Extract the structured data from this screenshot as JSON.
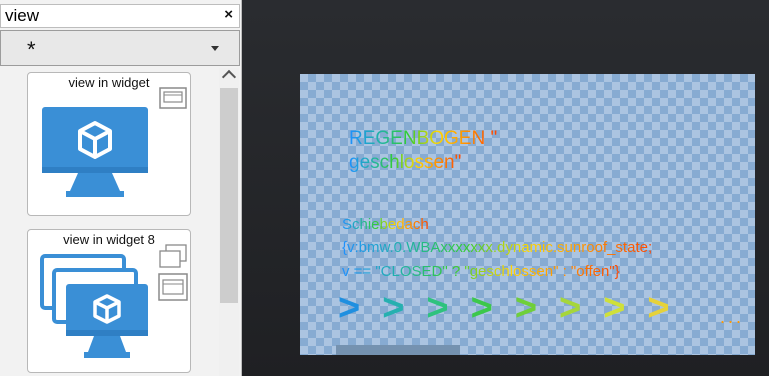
{
  "search": {
    "value": "view",
    "clear_glyph": "×"
  },
  "filter": {
    "value": "*"
  },
  "widgets": [
    {
      "label": "view in widget",
      "icon": "monitor-cube-icon",
      "badge_icon": "window-icon"
    },
    {
      "label": "view in widget 8",
      "icon": "stacked-monitors-cube-icon",
      "badge_icon": "windows-stack-icon"
    }
  ],
  "preview": {
    "title_line1": "REGENBOGEN \"",
    "title_line2": "geschlossen\"",
    "code_line1": "Schiebedach",
    "code_line2": "{v:bmw.0.WBAxxxxxxx.dynamic.sunroof_state;",
    "code_line3": "v == \"CLOSED\" ? \"geschlossen\" : \"offen\"}",
    "arrows": [
      ">",
      ">",
      ">",
      ">",
      ">",
      ">",
      ">",
      ">"
    ],
    "arrow_colors": [
      "#1f8fe0",
      "#26b0b0",
      "#2ec27e",
      "#3cc84a",
      "#6fcf3a",
      "#a6d63a",
      "#cfe03a",
      "#e6d23a"
    ],
    "dots": "..."
  },
  "colors": {
    "accent_blue": "#3a8fd6",
    "canvas_bg": "#2b2d31",
    "panel_bg": "#f2f2f2"
  }
}
